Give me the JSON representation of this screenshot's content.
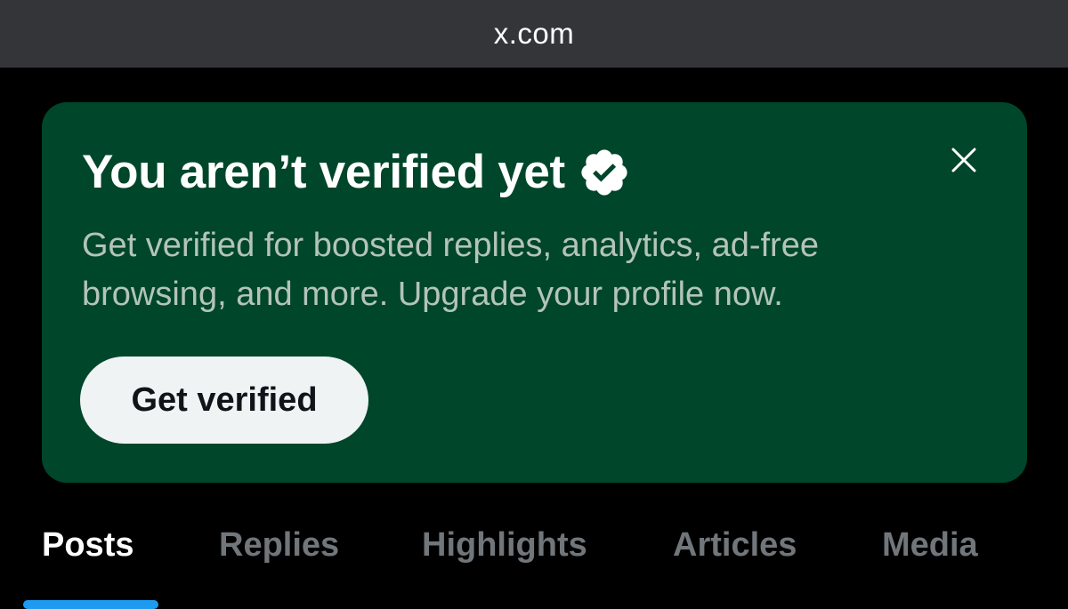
{
  "browser": {
    "url": "x.com"
  },
  "banner": {
    "title": "You aren’t verified yet",
    "description": "Get verified for boosted replies, analytics, ad-free browsing, and more. Upgrade your profile now.",
    "cta_label": "Get verified",
    "background_color": "#00462a",
    "badge_icon": "verified-badge-icon",
    "close_icon": "close-icon"
  },
  "tabs": [
    {
      "label": "Posts",
      "active": true
    },
    {
      "label": "Replies",
      "active": false
    },
    {
      "label": "Highlights",
      "active": false
    },
    {
      "label": "Articles",
      "active": false
    },
    {
      "label": "Media",
      "active": false
    }
  ],
  "accent_color": "#1d9bf0"
}
